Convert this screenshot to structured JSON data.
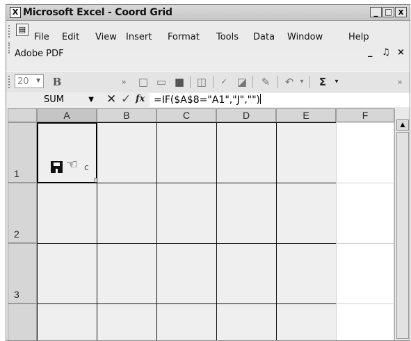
{
  "window": {
    "title": "Microsoft Excel - Coord Grid",
    "app_icon": "excel-icon",
    "buttons": [
      "_",
      "□",
      "x"
    ]
  },
  "menu": {
    "icon": "workbook-icon",
    "items": [
      "File",
      "Edit",
      "View",
      "Insert",
      "Format",
      "Tools",
      "Data",
      "Window",
      "Help"
    ],
    "row2": [
      "Adobe PDF"
    ],
    "mdi_buttons": [
      "_",
      "♫",
      "×"
    ]
  },
  "toolbar": {
    "font_size": "20",
    "bold": "B",
    "sum": "Σ"
  },
  "formula_bar": {
    "name_box": "SUM",
    "cancel": "✕",
    "enter": "✓",
    "fx": "fx",
    "formula": "=IF($A$8=\"A1\",\"J\",\"\")"
  },
  "grid": {
    "columns": [
      "A",
      "B",
      "C",
      "D",
      "E",
      "F"
    ],
    "rows": [
      "1",
      "2",
      "3",
      ""
    ],
    "cell_a1": {
      "icons": [
        "floppy-disk-icon",
        "hand-cursor-icon"
      ],
      "trailing_text": "c"
    }
  }
}
